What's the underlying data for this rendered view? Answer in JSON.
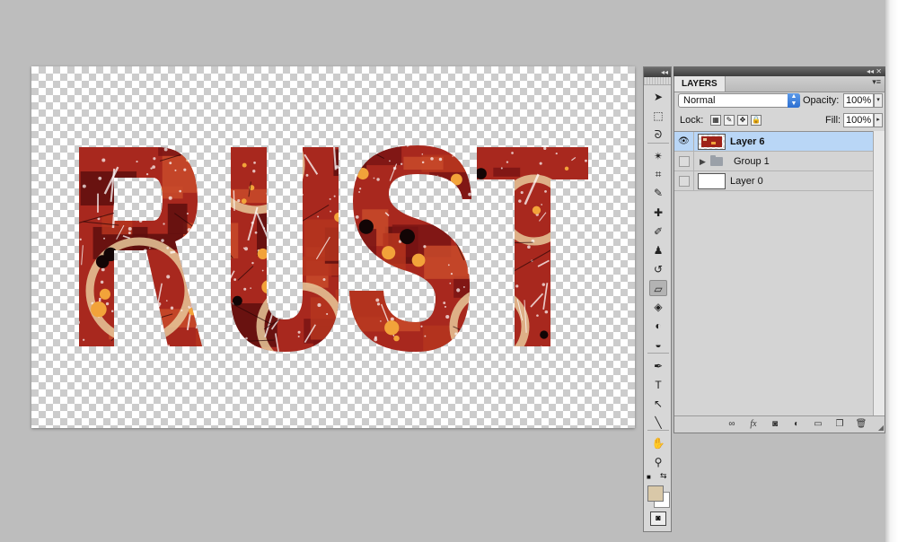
{
  "canvas": {
    "artwork_text": "RUST",
    "colors": {
      "rust_dark": "#7a1414",
      "rust_mid": "#a8281e",
      "rust_light": "#c84a2a",
      "orange": "#f2a33a",
      "tan": "#e8c89a"
    }
  },
  "toolbox": {
    "tools": [
      {
        "name": "move-tool-icon",
        "glyph": "➤"
      },
      {
        "name": "marquee-tool-icon",
        "glyph": "⬚"
      },
      {
        "name": "lasso-tool-icon",
        "glyph": "ᘐ"
      },
      {
        "name": "magic-wand-tool-icon",
        "glyph": "✴"
      },
      {
        "name": "crop-tool-icon",
        "glyph": "⌗"
      },
      {
        "name": "eyedropper-tool-icon",
        "glyph": "✎"
      },
      {
        "name": "healing-brush-tool-icon",
        "glyph": "✚"
      },
      {
        "name": "brush-tool-icon",
        "glyph": "✐"
      },
      {
        "name": "stamp-tool-icon",
        "glyph": "♟"
      },
      {
        "name": "history-brush-tool-icon",
        "glyph": "↺"
      },
      {
        "name": "eraser-tool-icon",
        "glyph": "▱"
      },
      {
        "name": "paint-bucket-tool-icon",
        "glyph": "◈"
      },
      {
        "name": "blur-tool-icon",
        "glyph": "◐"
      },
      {
        "name": "dodge-tool-icon",
        "glyph": "◒"
      },
      {
        "name": "pen-tool-icon",
        "glyph": "✒"
      },
      {
        "name": "type-tool-icon",
        "glyph": "T"
      },
      {
        "name": "path-selection-tool-icon",
        "glyph": "↖"
      },
      {
        "name": "line-tool-icon",
        "glyph": "╲"
      },
      {
        "name": "hand-tool-icon",
        "glyph": "✋"
      },
      {
        "name": "zoom-tool-icon",
        "glyph": "⚲"
      }
    ],
    "foreground_color": "#d9c8a8",
    "background_color": "#ffffff"
  },
  "layers_panel": {
    "tab": "LAYERS",
    "blend_mode": "Normal",
    "opacity_label": "Opacity:",
    "opacity_value": "100%",
    "lock_label": "Lock:",
    "fill_label": "Fill:",
    "fill_value": "100%",
    "layers": [
      {
        "name": "Layer 6",
        "visible": true,
        "selected": true
      },
      {
        "name": "Group 1",
        "visible": false,
        "selected": false
      },
      {
        "name": "Layer 0",
        "visible": false,
        "selected": false
      }
    ]
  }
}
